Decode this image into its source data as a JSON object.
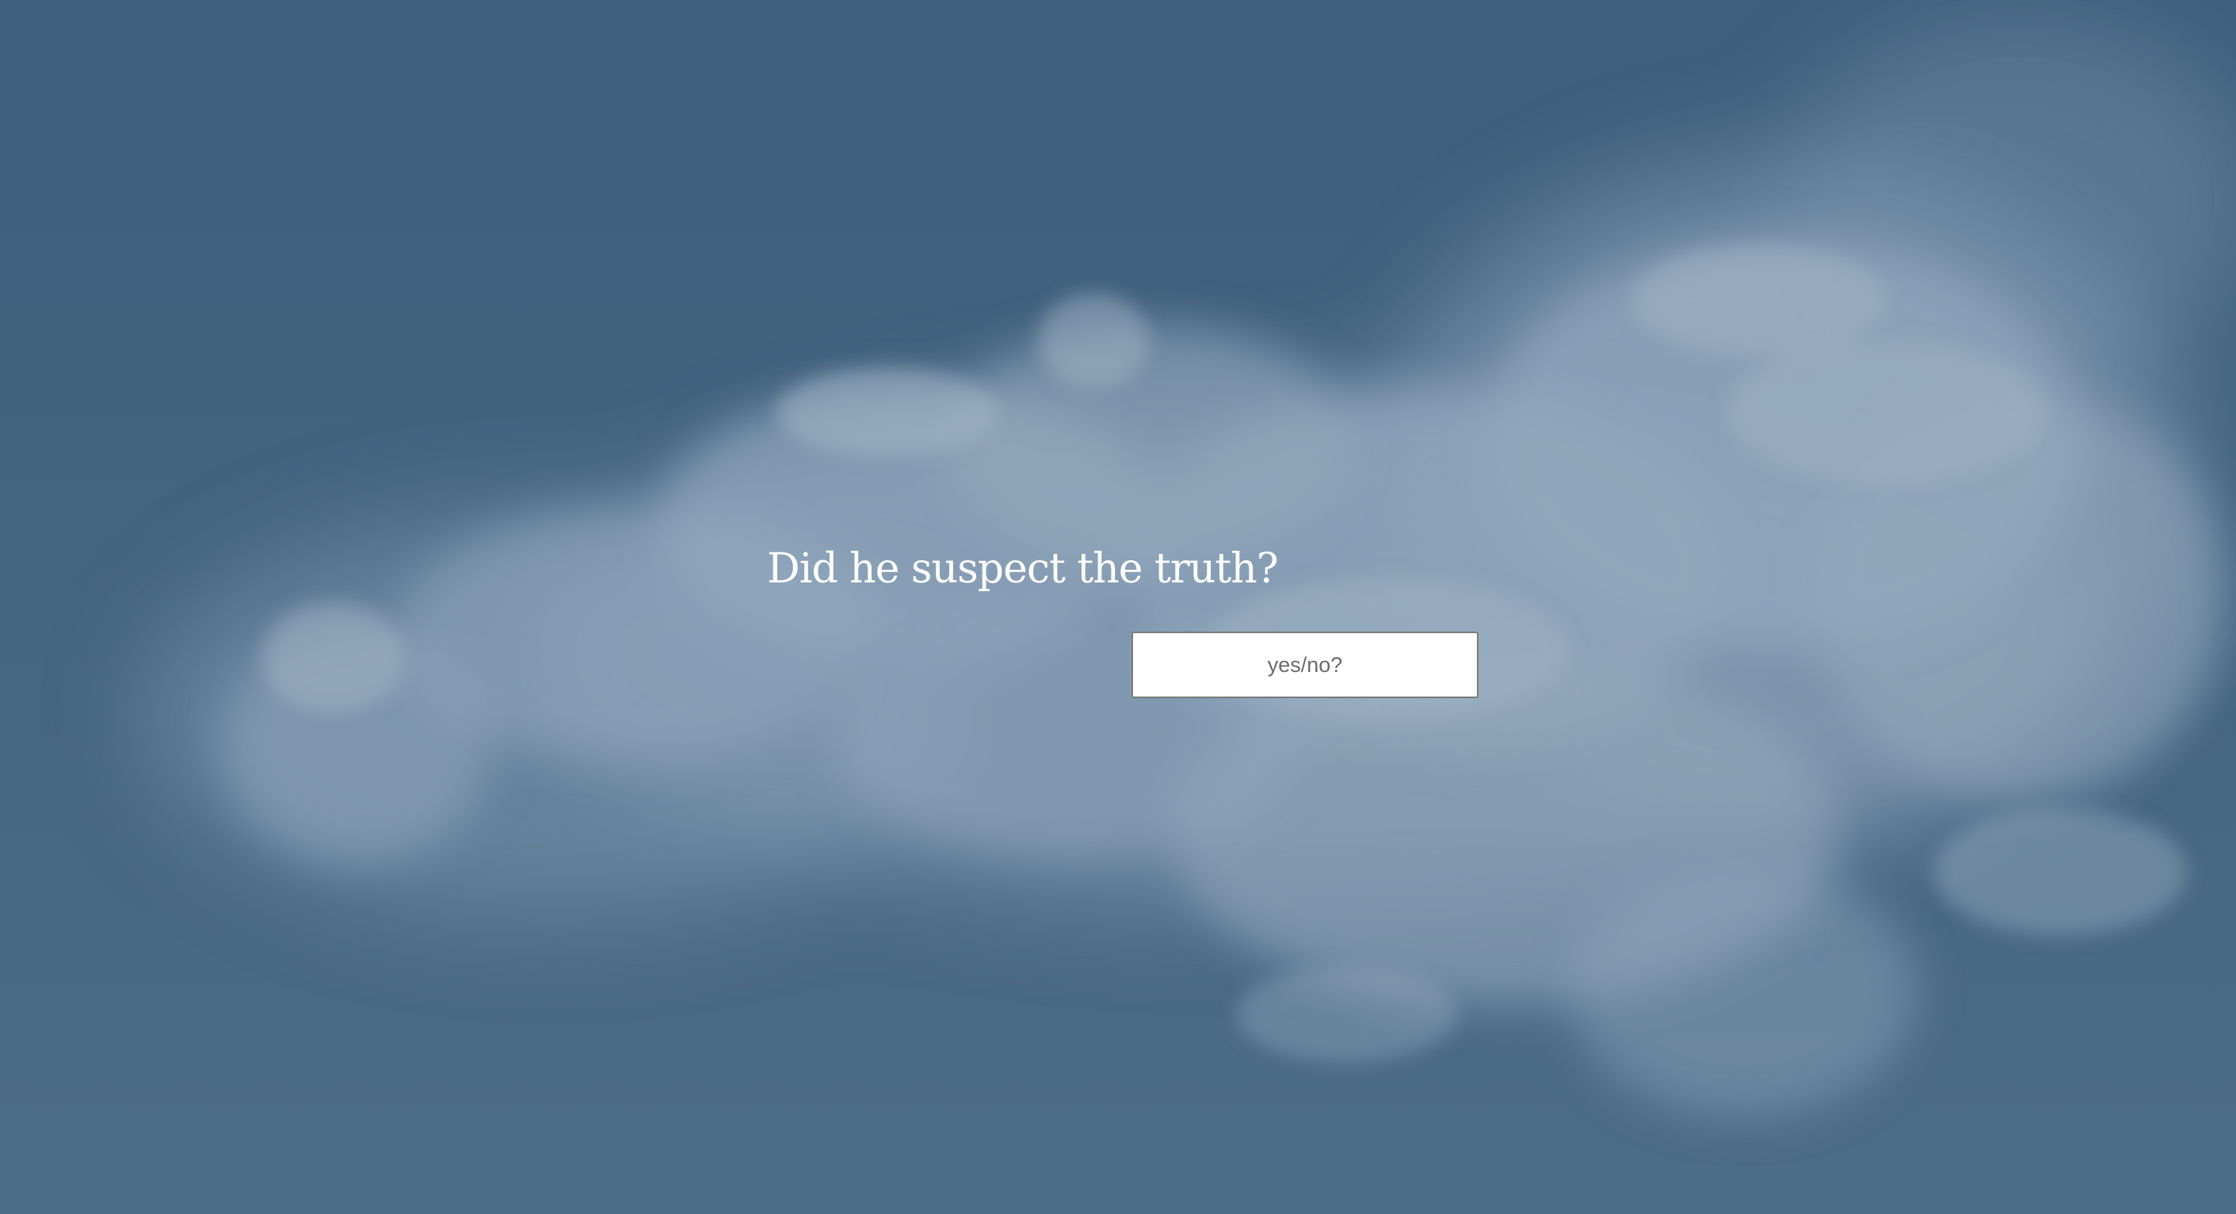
{
  "question": {
    "text": "Did he suspect the truth?"
  },
  "answer_input": {
    "value": "",
    "placeholder": "yes/no?"
  },
  "background": {
    "sky_color": "#41617f",
    "smoke_color": "#8fa6bc"
  }
}
